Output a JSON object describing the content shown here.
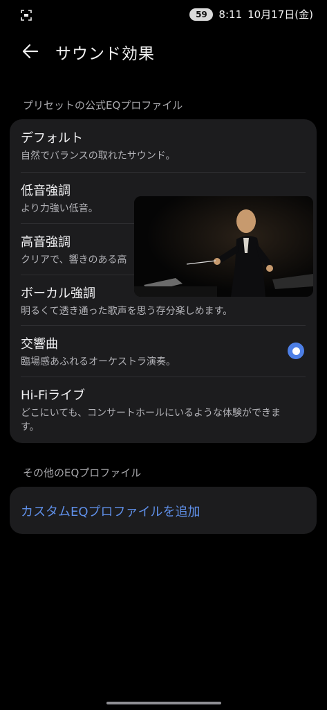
{
  "status_bar": {
    "badge": "59",
    "time": "8:11",
    "date": "10月17日(金)"
  },
  "header": {
    "title": "サウンド効果"
  },
  "preset_section": {
    "label": "プリセットの公式EQプロファイル",
    "items": [
      {
        "title": "デフォルト",
        "desc": "自然でバランスの取れたサウンド。",
        "selected": false
      },
      {
        "title": "低音強調",
        "desc": "より力強い低音。",
        "selected": false
      },
      {
        "title": "高音強調",
        "desc": "クリアで、響きのある高",
        "selected": false
      },
      {
        "title": "ボーカル強調",
        "desc": "明るくて透き通った歌声を思う存分楽しめます。",
        "selected": false
      },
      {
        "title": "交響曲",
        "desc": "臨場感あふれるオーケストラ演奏。",
        "selected": true
      },
      {
        "title": "Hi-Fiライブ",
        "desc": "どこにいても、コンサートホールにいるような体験ができます。",
        "selected": false
      }
    ]
  },
  "other_section": {
    "label": "その他のEQプロファイル",
    "add_custom": "カスタムEQプロファイルを追加"
  },
  "icons": {
    "back": "arrow-left-icon",
    "radio": "radio-selected-icon",
    "screenshot": "screen-record-icon"
  },
  "colors": {
    "accent": "#4d7fe6",
    "link": "#5f8fe8",
    "card": "#1c1c1e",
    "background": "#000000"
  }
}
